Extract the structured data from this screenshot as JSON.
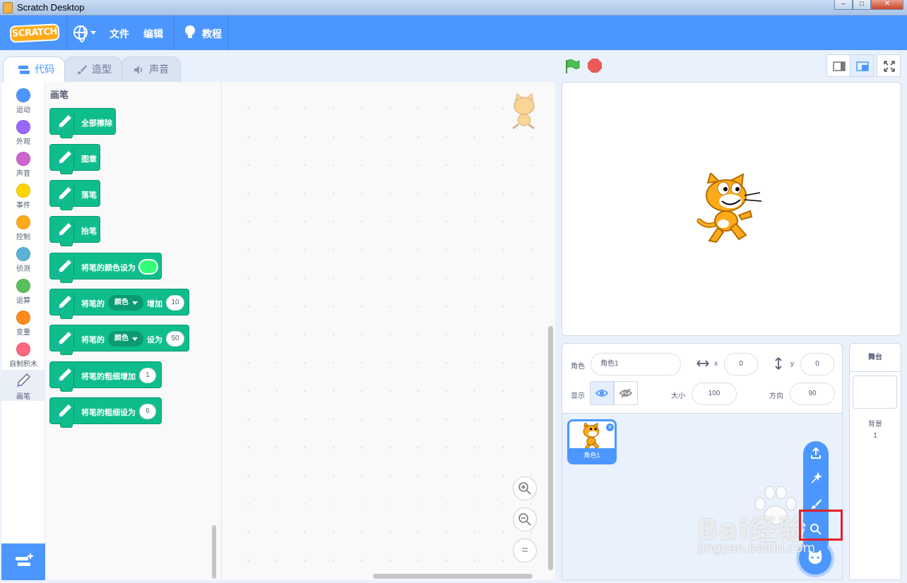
{
  "window": {
    "title": "Scratch Desktop"
  },
  "menu": {
    "logo": "SCRATCH",
    "file": "文件",
    "edit": "编辑",
    "tutorials": "教程"
  },
  "tabs": {
    "code": "代码",
    "costumes": "造型",
    "sounds": "声音"
  },
  "categories": [
    {
      "label": "运动",
      "color": "#4c97ff"
    },
    {
      "label": "外观",
      "color": "#9966ff"
    },
    {
      "label": "声音",
      "color": "#cf63cf"
    },
    {
      "label": "事件",
      "color": "#ffd500"
    },
    {
      "label": "控制",
      "color": "#ffab19"
    },
    {
      "label": "侦测",
      "color": "#5cb1d6"
    },
    {
      "label": "运算",
      "color": "#59c059"
    },
    {
      "label": "变量",
      "color": "#ff8c1a"
    },
    {
      "label": "自制积木",
      "color": "#ff6680"
    },
    {
      "label": "画笔",
      "color": "#0fbd8c"
    }
  ],
  "palette": {
    "title": "画笔",
    "blocks": {
      "clear": "全部擦除",
      "stamp": "图章",
      "pen_down": "落笔",
      "pen_up": "抬笔",
      "set_color_to": "将笔的颜色设为",
      "change_param_prefix": "将笔的",
      "change_param_dropdown": "颜色",
      "change_param_suffix": "增加",
      "change_param_value": "10",
      "set_param_prefix": "将笔的",
      "set_param_dropdown": "颜色",
      "set_param_suffix": "设为",
      "set_param_value": "50",
      "change_size": "将笔的粗细增加",
      "change_size_value": "1",
      "set_size": "将笔的粗细设为",
      "set_size_value": "6"
    }
  },
  "zoom": {
    "reset": "="
  },
  "sprite": {
    "label": "角色",
    "name": "角色1",
    "x_label": "x",
    "x": "0",
    "y_label": "y",
    "y": "0",
    "show_label": "显示",
    "size_label": "大小",
    "size": "100",
    "direction_label": "方向",
    "direction": "90"
  },
  "sprite_list": [
    {
      "name": "角色1"
    }
  ],
  "stage_pane": {
    "title": "舞台",
    "backdrops_label": "背景",
    "backdrops_count": "1"
  },
  "watermark": {
    "main": "Bai经验",
    "sub": "jingyan.baidu.com"
  },
  "colors": {
    "accent": "#4c97ff",
    "pen": "#0fbd8c",
    "pen_swatch": "#33ff77",
    "stop": "#ec5959",
    "flag": "#4cbf56"
  }
}
